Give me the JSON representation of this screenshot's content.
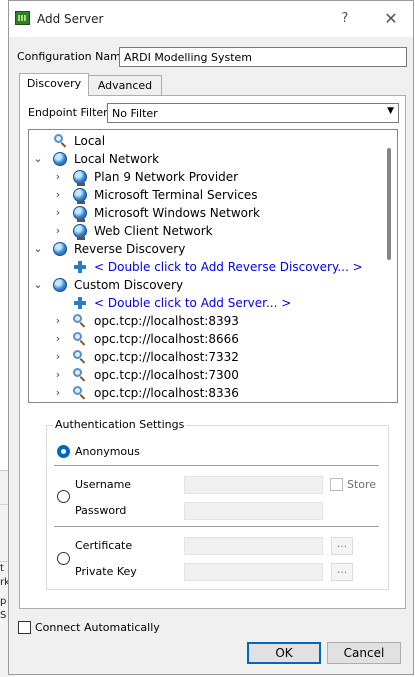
{
  "window": {
    "title": "Add Server",
    "help_label": "?",
    "close_label": "✕"
  },
  "config": {
    "label": "Configuration Name",
    "value": "ARDI Modelling System"
  },
  "tabs": [
    {
      "label": "Discovery"
    },
    {
      "label": "Advanced"
    }
  ],
  "endpoint_filter": {
    "label": "Endpoint Filter:",
    "value": "No Filter"
  },
  "tree": {
    "items": [
      {
        "label": "Local",
        "icon": "search-icon"
      },
      {
        "label": "Local Network",
        "icon": "globe-icon",
        "expanded": true
      },
      {
        "label": "Plan 9 Network Provider",
        "icon": "network-globe-icon"
      },
      {
        "label": "Microsoft Terminal Services",
        "icon": "network-globe-icon"
      },
      {
        "label": "Microsoft Windows Network",
        "icon": "network-globe-icon"
      },
      {
        "label": "Web Client Network",
        "icon": "network-globe-icon"
      },
      {
        "label": "Reverse Discovery",
        "icon": "globe-icon",
        "expanded": true
      },
      {
        "label": "< Double click to Add Reverse Discovery... >",
        "icon": "plus-icon"
      },
      {
        "label": "Custom Discovery",
        "icon": "globe-icon",
        "expanded": true
      },
      {
        "label": "< Double click to Add Server... >",
        "icon": "plus-icon"
      },
      {
        "label": "opc.tcp://localhost:8393",
        "icon": "search-icon"
      },
      {
        "label": "opc.tcp://localhost:8666",
        "icon": "search-icon"
      },
      {
        "label": "opc.tcp://localhost:7332",
        "icon": "search-icon"
      },
      {
        "label": "opc.tcp://localhost:7300",
        "icon": "search-icon"
      },
      {
        "label": "opc.tcp://localhost:8336",
        "icon": "search-icon"
      }
    ]
  },
  "auth": {
    "title": "Authentication Settings",
    "anonymous_label": "Anonymous",
    "username_label": "Username",
    "password_label": "Password",
    "store_label": "Store",
    "certificate_label": "Certificate",
    "private_key_label": "Private Key",
    "browse_label": "..."
  },
  "connect_automatically": {
    "label": "Connect Automatically",
    "checked": false
  },
  "buttons": {
    "ok": "OK",
    "cancel": "Cancel"
  },
  "colors": {
    "accent": "#0067c0",
    "link": "#0000ee"
  },
  "background_app": {
    "visible_chars": [
      "t",
      "rk",
      "p",
      "S"
    ]
  }
}
